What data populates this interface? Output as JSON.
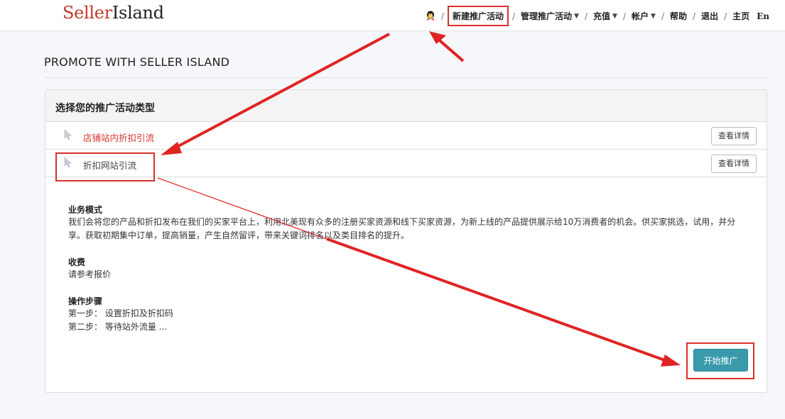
{
  "header": {
    "logo_part1": "Seller",
    "logo_part2": "Island",
    "nav": [
      {
        "label": "新建推广活动",
        "dropdown": false
      },
      {
        "label": "管理推广活动",
        "dropdown": true
      },
      {
        "label": "充值",
        "dropdown": true
      },
      {
        "label": "帐户",
        "dropdown": true
      },
      {
        "label": "帮助",
        "dropdown": false
      },
      {
        "label": "退出",
        "dropdown": false
      },
      {
        "label": "主页",
        "dropdown": false
      }
    ],
    "lang": "En",
    "separator": "/"
  },
  "page": {
    "title": "PROMOTE WITH SELLER ISLAND"
  },
  "panel": {
    "title": "选择您的推广活动类型",
    "options": [
      {
        "label": "店铺站内折扣引流",
        "button": "查看详情"
      },
      {
        "label": "折扣网站引流",
        "button": "查看详情"
      }
    ]
  },
  "detail": {
    "model_title": "业务模式",
    "model_text": "我们会将您的产品和折扣发布在我们的买家平台上，利用北美现有众多的注册买家资源和线下买家资源，为新上线的产品提供展示给10万消费者的机会。供买家挑选，试用，并分享。获取初期集中订单，提高销量，产生自然留评，带来关键词排名以及类目排名的提升。",
    "fee_title": "收费",
    "fee_text": "请参考报价",
    "steps_title": "操作步骤",
    "step1": "第一步： 设置折扣及折扣码",
    "step2": "第二步： 等待站外流量 ..."
  },
  "actions": {
    "start_label": "开始推广"
  },
  "colors": {
    "highlight": "#d9302c",
    "primary_button": "#3a9aab",
    "red_text": "#d9302c"
  }
}
